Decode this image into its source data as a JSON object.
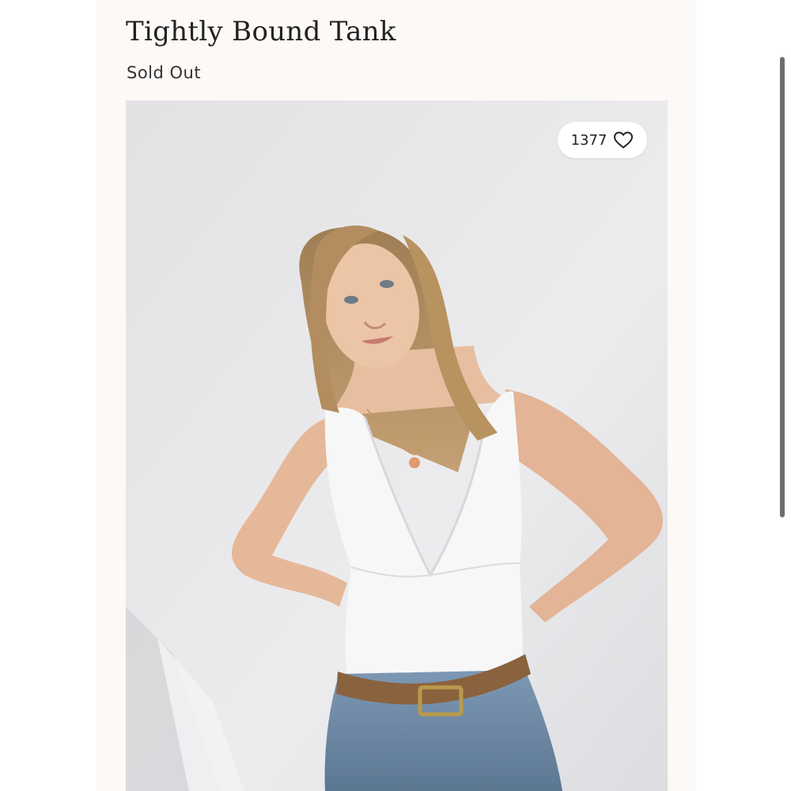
{
  "product": {
    "title": "Tightly Bound Tank",
    "status": "Sold Out"
  },
  "likes": {
    "count": "1377",
    "icon": "heart-icon"
  },
  "colors": {
    "page_background": "#fdf9f6",
    "text": "#222222"
  }
}
